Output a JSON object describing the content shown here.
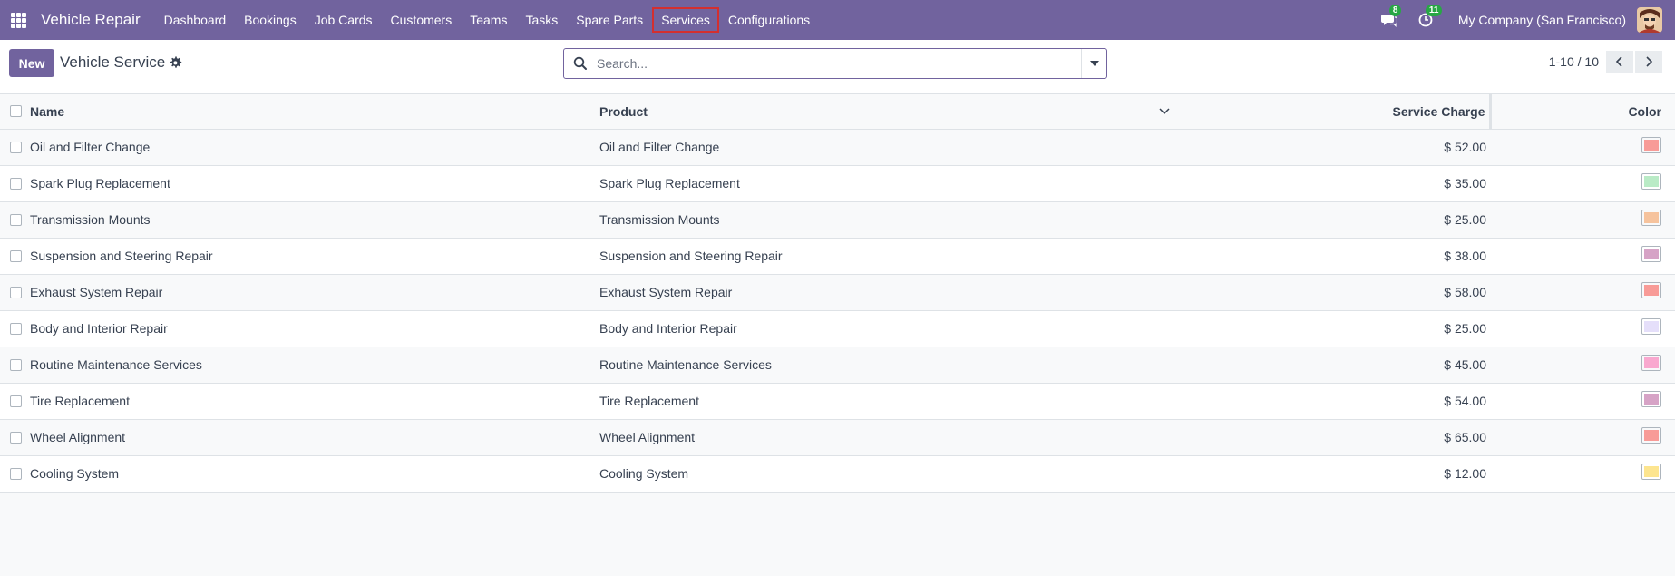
{
  "navbar": {
    "app_name": "Vehicle Repair",
    "menu": [
      {
        "label": "Dashboard"
      },
      {
        "label": "Bookings"
      },
      {
        "label": "Job Cards"
      },
      {
        "label": "Customers"
      },
      {
        "label": "Teams"
      },
      {
        "label": "Tasks"
      },
      {
        "label": "Spare Parts"
      },
      {
        "label": "Services"
      },
      {
        "label": "Configurations"
      }
    ],
    "messages_badge": "8",
    "activities_badge": "11",
    "company": "My Company (San Francisco)"
  },
  "control": {
    "new_label": "New",
    "title": "Vehicle Service",
    "search_placeholder": "Search...",
    "pager": "1-10 / 10"
  },
  "table": {
    "headers": {
      "name": "Name",
      "product": "Product",
      "charge": "Service Charge",
      "color": "Color"
    },
    "rows": [
      {
        "name": "Oil and Filter Change",
        "product": "Oil and Filter Change",
        "charge": "$ 52.00",
        "color": "#f89b97"
      },
      {
        "name": "Spark Plug Replacement",
        "product": "Spark Plug Replacement",
        "charge": "$ 35.00",
        "color": "#b9ebc6"
      },
      {
        "name": "Transmission Mounts",
        "product": "Transmission Mounts",
        "charge": "$ 25.00",
        "color": "#f6c39d"
      },
      {
        "name": "Suspension and Steering Repair",
        "product": "Suspension and Steering Repair",
        "charge": "$ 38.00",
        "color": "#d6a3c6"
      },
      {
        "name": "Exhaust System Repair",
        "product": "Exhaust System Repair",
        "charge": "$ 58.00",
        "color": "#f89b97"
      },
      {
        "name": "Body and Interior Repair",
        "product": "Body and Interior Repair",
        "charge": "$ 25.00",
        "color": "#e5dffa"
      },
      {
        "name": "Routine Maintenance Services",
        "product": "Routine Maintenance Services",
        "charge": "$ 45.00",
        "color": "#f9a8cf"
      },
      {
        "name": "Tire Replacement",
        "product": "Tire Replacement",
        "charge": "$ 54.00",
        "color": "#d6a3c6"
      },
      {
        "name": "Wheel Alignment",
        "product": "Wheel Alignment",
        "charge": "$ 65.00",
        "color": "#f89b97"
      },
      {
        "name": "Cooling System",
        "product": "Cooling System",
        "charge": "$ 12.00",
        "color": "#fde58f"
      }
    ]
  },
  "colors": {
    "brand": "#71639e",
    "highlight": "#d32f2f",
    "badge": "#28a745"
  },
  "icons": [
    "apps-grid-icon",
    "chat-icon",
    "clock-icon",
    "gear-icon",
    "search-icon",
    "caret-down-icon",
    "chevron-left-icon",
    "chevron-right-icon",
    "chevron-down-icon"
  ]
}
